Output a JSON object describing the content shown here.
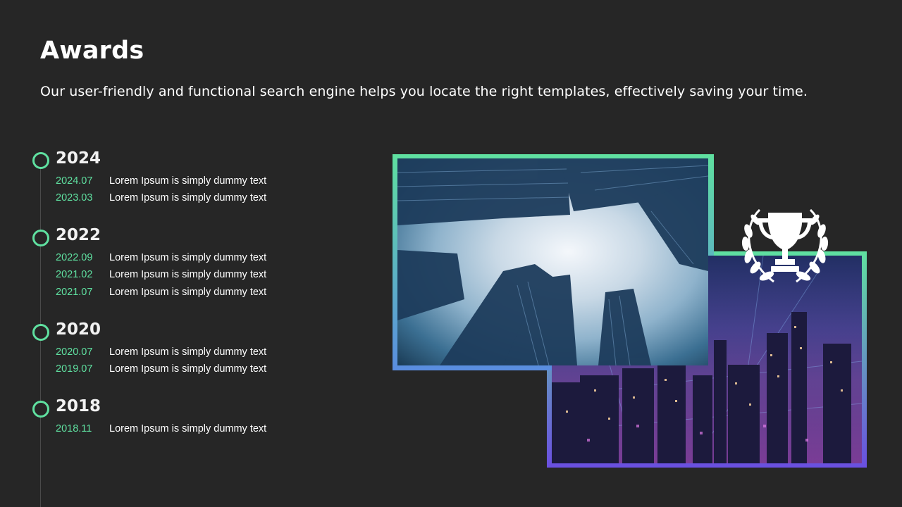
{
  "slide": {
    "title": "Awards",
    "subtitle": "Our user-friendly and functional search engine helps you locate the right templates, effectively saving your time."
  },
  "timeline": [
    {
      "year": "2024",
      "entries": [
        {
          "date": "2024.07",
          "text": "Lorem Ipsum is simply dummy text"
        },
        {
          "date": "2023.03",
          "text": "Lorem Ipsum is simply dummy text"
        }
      ]
    },
    {
      "year": "2022",
      "entries": [
        {
          "date": "2022.09",
          "text": "Lorem Ipsum is simply dummy text"
        },
        {
          "date": "2021.02",
          "text": "Lorem Ipsum is simply dummy text"
        },
        {
          "date": "2021.07",
          "text": "Lorem Ipsum is simply dummy text"
        }
      ]
    },
    {
      "year": "2020",
      "entries": [
        {
          "date": "2020.07",
          "text": "Lorem Ipsum is simply dummy text"
        },
        {
          "date": "2019.07",
          "text": "Lorem Ipsum is simply dummy text"
        }
      ]
    },
    {
      "year": "2018",
      "entries": [
        {
          "date": "2018.11",
          "text": "Lorem Ipsum is simply dummy text"
        }
      ]
    }
  ],
  "colors": {
    "background": "#262626",
    "accent_green": "#5fe0a0",
    "accent_blue": "#5a8de0",
    "accent_purple": "#6a4fe0"
  },
  "icons": {
    "trophy": "trophy-laurel-icon"
  }
}
